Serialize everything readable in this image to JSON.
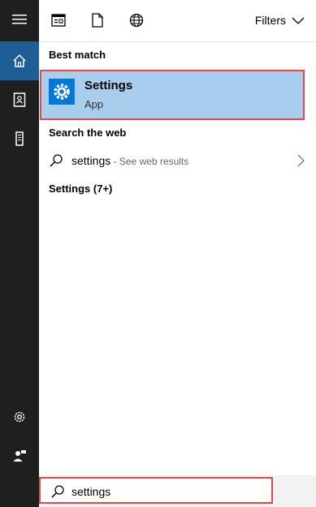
{
  "rail": {
    "items": [
      {
        "icon": "hamburger-menu-icon"
      },
      {
        "icon": "home-icon",
        "active": true
      },
      {
        "icon": "notebook-icon"
      },
      {
        "icon": "device-icon"
      },
      {
        "icon": "gear-icon"
      },
      {
        "icon": "feedback-person-icon"
      }
    ]
  },
  "topbar": {
    "icons": [
      "apps-icon",
      "documents-icon",
      "web-globe-icon"
    ],
    "filters_label": "Filters"
  },
  "results": {
    "best_match_header": "Best match",
    "best_match": {
      "title": "Settings",
      "subtitle": "App"
    },
    "search_web_header": "Search the web",
    "web_result": {
      "query": "settings",
      "hint": " - See web results"
    },
    "settings_group_header": "Settings (7+)"
  },
  "searchbox": {
    "value": "settings"
  },
  "colors": {
    "rail_bg": "#1f1f1f",
    "rail_active": "#1e5d96",
    "best_match_bg": "#a9cdec",
    "app_tile": "#0078d7",
    "highlight_border": "#e8474c"
  }
}
